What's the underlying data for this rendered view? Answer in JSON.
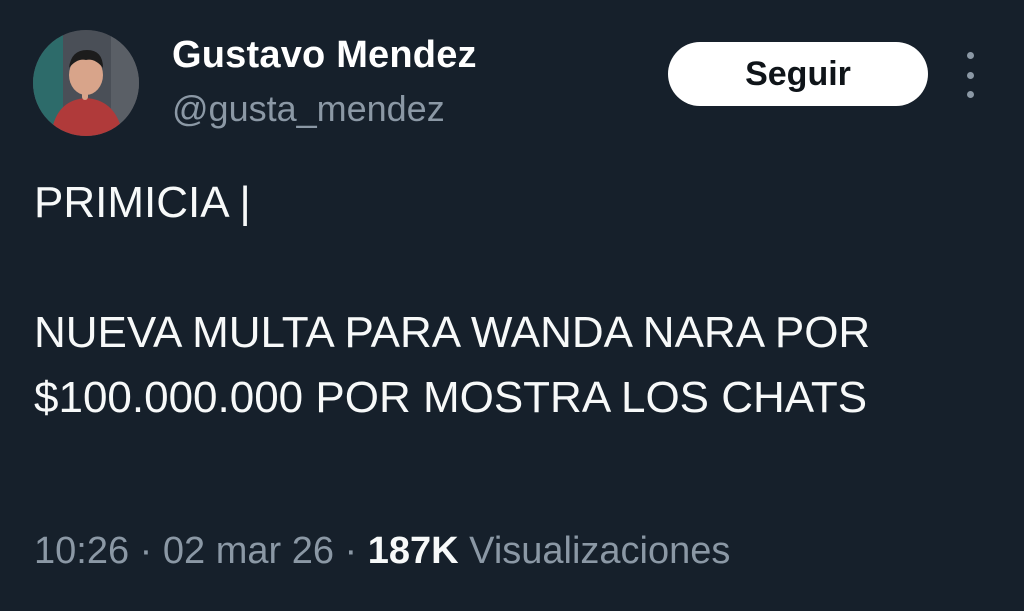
{
  "author": {
    "display_name": "Gustavo Mendez",
    "handle": "@gusta_mendez",
    "avatar_icon": "user-avatar-photo"
  },
  "actions": {
    "follow_label": "Seguir",
    "more_icon": "more-vertical-icon"
  },
  "tweet": {
    "line1": "PRIMICIA |",
    "line2": "NUEVA MULTA PARA WANDA NARA POR $100.000.000 POR MOSTRA LOS CHATS"
  },
  "meta": {
    "time": "10:26",
    "separator": "·",
    "date": "02 mar 26",
    "views_count": "187K",
    "views_label": "Visualizaciones"
  },
  "colors": {
    "background": "#16202b",
    "text": "#f7f9f9",
    "secondary": "#8b98a5",
    "button_bg": "#ffffff"
  }
}
